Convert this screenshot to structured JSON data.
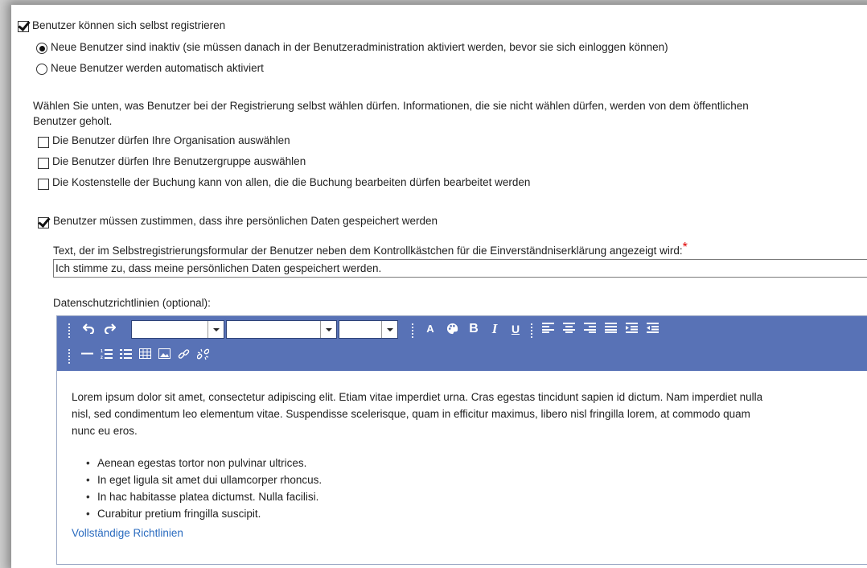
{
  "self_registration": {
    "label": "Benutzer können sich selbst registrieren",
    "checked": true,
    "radio_options": [
      {
        "label": "Neue Benutzer sind inaktiv (sie müssen danach in der Benutzeradministration aktiviert werden, bevor sie sich einloggen können)",
        "selected": true
      },
      {
        "label": "Neue Benutzer werden automatisch aktiviert",
        "selected": false
      }
    ]
  },
  "selection_info": {
    "line1": "Wählen Sie unten, was Benutzer bei der Registrierung selbst wählen dürfen. Informationen, die sie nicht wählen dürfen, werden von dem öffentlichen",
    "line2": "Benutzer geholt.",
    "options": [
      {
        "label": "Die Benutzer dürfen Ihre Organisation auswählen",
        "checked": false
      },
      {
        "label": "Die Benutzer dürfen Ihre Benutzergruppe auswählen",
        "checked": false
      },
      {
        "label": "Die Kostenstelle der Buchung kann von allen, die die Buchung bearbeiten dürfen bearbeitet werden",
        "checked": false
      }
    ]
  },
  "consent": {
    "label": "Benutzer müssen zustimmen, dass ihre persönlichen Daten gespeichert werden",
    "checked": true,
    "text_label": "Text, der im Selbstregistrierungsformular der Benutzer neben dem Kontrollkästchen für die Einverständniserklärung angezeigt wird:",
    "required_mark": "*",
    "text_value": "Ich stimme zu, dass meine persönlichen Daten gespeichert werden."
  },
  "privacy": {
    "label": "Datenschutzrichtlinien (optional):",
    "toolbar_color": "#5872b6",
    "toolbar_icons": [
      "undo-icon",
      "redo-icon",
      "font-family-select",
      "font-size-select",
      "heading-select",
      "font-color-icon",
      "palette-icon",
      "bold-icon",
      "italic-icon",
      "underline-icon",
      "align-left-icon",
      "align-center-icon",
      "align-right-icon",
      "justify-icon",
      "indent-icon",
      "outdent-icon",
      "horizontal-rule-icon",
      "ordered-list-icon",
      "unordered-list-icon",
      "table-icon",
      "image-icon",
      "link-icon",
      "unlink-icon"
    ],
    "toolbar_letters": {
      "font_color": "A",
      "bold": "B",
      "italic": "I",
      "underline": "U"
    },
    "paragraph_line1": "Lorem ipsum dolor sit amet, consectetur adipiscing elit. Etiam vitae imperdiet urna. Cras egestas tincidunt sapien id dictum. Nam imperdiet nulla",
    "paragraph_line2": "nisl, sed condimentum leo elementum vitae. Suspendisse scelerisque, quam in efficitur maximus, libero nisl fringilla lorem, at commodo quam",
    "paragraph_line3": "nunc eu eros.",
    "bullets": [
      "Aenean egestas tortor non pulvinar ultrices.",
      "In eget ligula sit amet dui ullamcorper rhoncus.",
      "In hac habitasse platea dictumst. Nulla facilisi.",
      "Curabitur pretium fringilla suscipit."
    ],
    "link_text": "Vollständige Richtlinien",
    "link_color": "#2a6bbf"
  }
}
